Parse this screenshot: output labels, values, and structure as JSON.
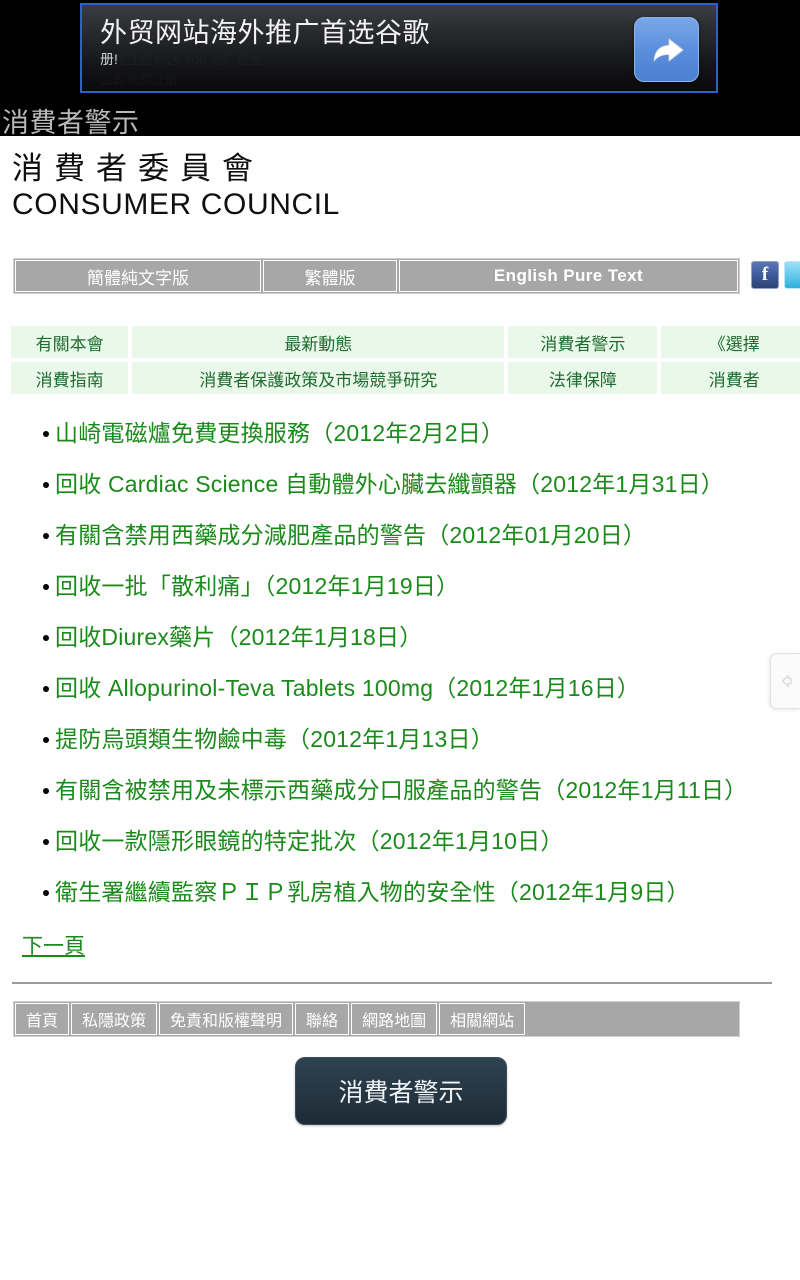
{
  "ad": {
    "headline": "外贸网站海外推广首选谷歌",
    "subline_visible": "册!",
    "subline_faint": "现在注册即送 300 元广告金",
    "subline_faint2": "立即免费注册",
    "cta_icon": "forward-arrow-icon"
  },
  "titlebar": {
    "title": "消費者警示"
  },
  "header": {
    "brand_zh": "消費者委員會",
    "brand_en": "CONSUMER COUNCIL"
  },
  "language_bar": {
    "buttons": [
      {
        "label": "簡體純文字版"
      },
      {
        "label": "繁體版"
      },
      {
        "label": "English Pure Text"
      }
    ]
  },
  "social": {
    "facebook_glyph": "f",
    "items": [
      {
        "name": "facebook-icon"
      },
      {
        "name": "twitter-icon"
      }
    ]
  },
  "nav": {
    "row1": [
      {
        "label": "有關本會"
      },
      {
        "label": "最新動態"
      },
      {
        "label": "消費者警示"
      },
      {
        "label": "《選擇"
      }
    ],
    "row2": [
      {
        "label": "消費指南"
      },
      {
        "label": "消費者保護政策及市場競爭研究"
      },
      {
        "label": "法律保障"
      },
      {
        "label": "消費者"
      }
    ]
  },
  "alerts": [
    {
      "title": "山崎電磁爐免費更換服務（2012年2月2日）"
    },
    {
      "title": "回收 Cardiac Science 自動體外心臟去纖顫器（2012年1月31日）"
    },
    {
      "title": "有關含禁用西藥成分減肥產品的警告（2012年01月20日）"
    },
    {
      "title": "回收一批「散利痛」（2012年1月19日）"
    },
    {
      "title": "回收Diurex藥片（2012年1月18日）"
    },
    {
      "title": "回收 Allopurinol-Teva Tablets 100mg（2012年1月16日）"
    },
    {
      "title": "提防烏頭類生物鹼中毒（2012年1月13日）"
    },
    {
      "title": "有關含被禁用及未標示西藥成分口服產品的警告（2012年1月11日）"
    },
    {
      "title": "回收一款隱形眼鏡的特定批次（2012年1月10日）"
    },
    {
      "title": "衛生署繼續監察ＰＩＰ乳房植入物的安全性（2012年1月9日）"
    }
  ],
  "pagination": {
    "next_label": "下一頁"
  },
  "footer": {
    "buttons": [
      {
        "label": "首頁"
      },
      {
        "label": "私隱政策"
      },
      {
        "label": "免責和版權聲明"
      },
      {
        "label": "聯絡"
      },
      {
        "label": "網路地圖"
      },
      {
        "label": "相關網站"
      }
    ]
  },
  "bottom_button": {
    "label": "消費者警示"
  },
  "edge_tab": {
    "icon": "chevron-left-icon"
  },
  "colors": {
    "link_green": "#1a8a1a",
    "nav_bg": "#e9f8e9",
    "nav_text": "#1f6b30",
    "button_gray": "#a7a7a7",
    "ad_border_blue": "#2c62c8",
    "bottom_button_dark": "#273744"
  }
}
